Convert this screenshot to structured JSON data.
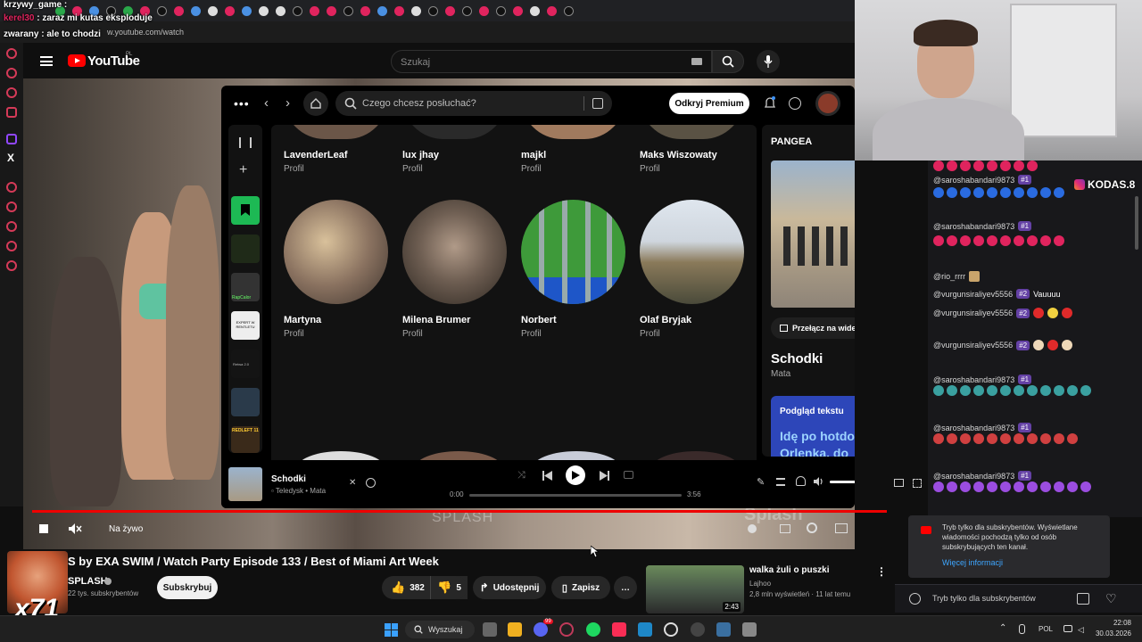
{
  "overlay_chat": [
    {
      "user": "krzywy_game",
      "message": ""
    },
    {
      "user": "kerel30",
      "message": "zaraz mi kutas eksploduje"
    },
    {
      "user": "zwarany",
      "message": "ale to chodzi"
    }
  ],
  "browser": {
    "url": "w.youtube.com/watch"
  },
  "youtube": {
    "logo_text": "YouTube",
    "logo_region": "PL",
    "search_placeholder": "Szukaj",
    "video_overlay_brand": "SPLASH",
    "video_overlay_brand2": "Splash",
    "live_label": "Na żywo",
    "title": "S by EXA SWIM / Watch Party Episode 133 / Best of Miami Art Week",
    "channel": "SPLASH",
    "subscribers": "22 tys. subskrybentów",
    "subscribe_label": "Subskrybuj",
    "likes": "382",
    "dislikes": "5",
    "share_label": "Udostępnij",
    "save_label": "Zapisz",
    "more_label": "…",
    "multiplier": "x71",
    "recommended": {
      "title": "walka żuli o puszki",
      "channel": "Lajhoo",
      "meta": "2,8 mln wyświetleń · 11 lat temu",
      "duration": "2:43"
    }
  },
  "spotify": {
    "search_placeholder": "Czego chcesz posłuchać?",
    "premium_label": "Odkryj Premium",
    "library_labels": [
      "RapCalor",
      "EXPERT W RENTLETU",
      "Retwa 2.0",
      "REDLEFT 11"
    ],
    "profiles_row1": [
      {
        "name": "LavenderLeaf",
        "type": "Profil"
      },
      {
        "name": "lux jhay",
        "type": "Profil"
      },
      {
        "name": "majkl",
        "type": "Profil"
      },
      {
        "name": "Maks Wiszowaty",
        "type": "Profil"
      }
    ],
    "profiles_row2": [
      {
        "name": "Martyna",
        "type": "Profil"
      },
      {
        "name": "Milena Brumer",
        "type": "Profil"
      },
      {
        "name": "Norbert",
        "type": "Profil"
      },
      {
        "name": "Olaf Bryjak",
        "type": "Profil"
      }
    ],
    "now_playing_panel": {
      "playlist": "PANGEA",
      "switch_video": "Przełącz na wideo",
      "song": "Schodki",
      "artist": "Mata",
      "lyrics_header": "Podgląd tekstu",
      "lyrics_preview": "Idę po hotdoga na Orlenka, do"
    },
    "player": {
      "song": "Schodki",
      "sub": "Teledysk • Mata",
      "time_current": "0:00",
      "time_total": "3:56",
      "progress": 0.0,
      "volume": 0.55
    }
  },
  "chat": {
    "overlay_handle": "KODAS.8",
    "messages": [
      {
        "user": "@saroshabandari9873",
        "badge": "#1",
        "text": ""
      },
      {
        "user": "@saroshabandari9873",
        "badge": "#1",
        "text": ""
      },
      {
        "user": "@rio_rrrr",
        "badge": "",
        "text": ""
      },
      {
        "user": "@vurgunsiraliyev5556",
        "badge": "#2",
        "text": "Vauuuu"
      },
      {
        "user": "@vurgunsiraliyev5556",
        "badge": "#2",
        "text": ""
      },
      {
        "user": "@vurgunsiraliyev5556",
        "badge": "#2",
        "text": ""
      },
      {
        "user": "@saroshabandari9873",
        "badge": "#1",
        "text": ""
      },
      {
        "user": "@saroshabandari9873",
        "badge": "#1",
        "text": ""
      },
      {
        "user": "@saroshabandari9873",
        "badge": "#1",
        "text": ""
      }
    ],
    "sub_notice": "Tryb tylko dla subskrybentów. Wyświetlane wiadomości pochodzą tylko od osób subskrybujących ten kanał.",
    "sub_notice_link": "Więcej informacji",
    "input_placeholder": "Tryb tylko dla subskrybentów"
  },
  "taskbar": {
    "search_label": "Wyszukaj",
    "language": "POL",
    "time": "22:08",
    "date": "30.03.2026",
    "notification_count": "99"
  },
  "colors": {
    "youtube_red": "#ff0000",
    "spotify_green": "#1ed760",
    "twitch_purple": "#6441a5"
  }
}
